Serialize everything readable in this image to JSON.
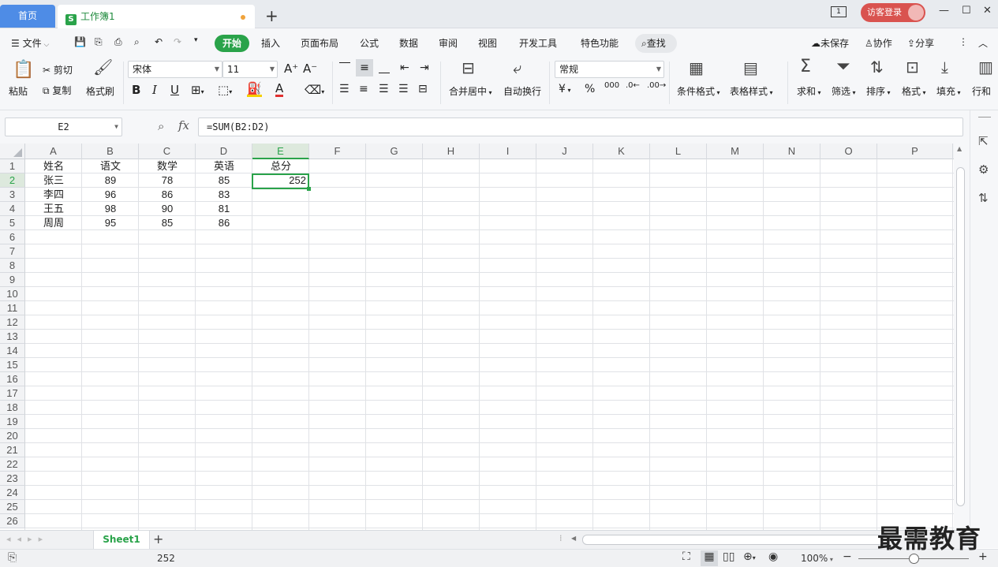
{
  "titlebar": {
    "home_tab": "首页",
    "doc_tab": "工作簿1",
    "doc_icon": "S",
    "add_tab": "+",
    "page_indicator": "1",
    "guest_login": "访客登录",
    "minimize": "—",
    "maximize": "☐",
    "close": "✕"
  },
  "menubar": {
    "file": "文件",
    "tabs": [
      "开始",
      "插入",
      "页面布局",
      "公式",
      "数据",
      "审阅",
      "视图",
      "开发工具",
      "特色功能"
    ],
    "search": "查找",
    "unsaved": "未保存",
    "collab": "协作",
    "share": "分享"
  },
  "ribbon": {
    "paste": "粘贴",
    "cut": "剪切",
    "copy": "复制",
    "format_painter": "格式刷",
    "font_name": "宋体",
    "font_size": "11",
    "bold": "B",
    "italic": "I",
    "underline": "U",
    "merge_center": "合并居中",
    "wrap_text": "自动换行",
    "number_format": "常规",
    "currency": "¥",
    "percent": "%",
    "thousands": "000",
    "conditional_format": "条件格式",
    "table_style": "表格样式",
    "sum": "求和",
    "filter": "筛选",
    "sort": "排序",
    "format": "格式",
    "fill": "填充",
    "row_col": "行和"
  },
  "formula_bar": {
    "name_box": "E2",
    "fx_label": "fx",
    "formula": "=SUM(B2:D2)"
  },
  "grid": {
    "columns": [
      "A",
      "B",
      "C",
      "D",
      "E",
      "F",
      "G",
      "H",
      "I",
      "J",
      "K",
      "L",
      "M",
      "N",
      "O",
      "P"
    ],
    "selected_column": "E",
    "rows": [
      "1",
      "2",
      "3",
      "4",
      "5",
      "6",
      "7",
      "8",
      "9",
      "10",
      "11",
      "12",
      "13",
      "14",
      "15",
      "16",
      "17",
      "18",
      "19",
      "20",
      "21",
      "22",
      "23",
      "24",
      "25",
      "26"
    ],
    "selected_row": "2",
    "data": [
      [
        "姓名",
        "语文",
        "数学",
        "英语",
        "总分"
      ],
      [
        "张三",
        "89",
        "78",
        "85",
        "252"
      ],
      [
        "李四",
        "96",
        "86",
        "83",
        ""
      ],
      [
        "王五",
        "98",
        "90",
        "81",
        ""
      ],
      [
        "周周",
        "95",
        "85",
        "86",
        ""
      ]
    ],
    "selected_cell": "E2"
  },
  "sheetbar": {
    "sheet_name": "Sheet1",
    "add_sheet": "+"
  },
  "statusbar": {
    "sum_value": "252",
    "zoom": "100%",
    "zoom_out": "−",
    "zoom_in": "+",
    "zoom_level": 0.5
  },
  "watermark": "最需教育"
}
